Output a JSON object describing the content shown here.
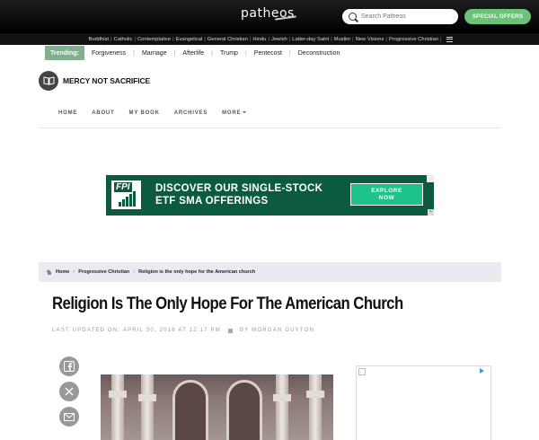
{
  "header": {
    "logo_text": "patheos",
    "search_placeholder": "Search Patheos",
    "special_offers_label": "SPECIAL OFFERS"
  },
  "categories": [
    "Buddhist",
    "Catholic",
    "Contemplative",
    "Evangelical",
    "General Christian",
    "Hindu",
    "Jewish",
    "Latter-day Saint",
    "Muslim",
    "New Visions",
    "Progressive Christian"
  ],
  "trending": {
    "label": "Trending:",
    "items": [
      "Forgiveness",
      "Marriage",
      "Afterlife",
      "Trump",
      "Pentecost",
      "Deconstruction"
    ]
  },
  "blog": {
    "title": "MERCY NOT SACRIFICE",
    "nav": [
      "HOME",
      "ABOUT",
      "MY BOOK",
      "ARCHIVES",
      "MORE"
    ]
  },
  "ad": {
    "logo": "FPI",
    "headline_line1": "DISCOVER OUR SINGLE-STOCK",
    "headline_line2": "ETF SMA OFFERINGS",
    "cta_line1": "EXPLORE",
    "cta_line2": "NOW",
    "brand_color": "#0c5b40",
    "cta_color": "#1ec28b"
  },
  "breadcrumb": [
    "Home",
    "Progressive Christian",
    "Religion is the only hope for the American church"
  ],
  "article": {
    "title": "Religion Is The Only Hope For The American Church",
    "updated": "LAST UPDATED ON: APRIL 30, 2016 AT 12:17 PM",
    "byline": "BY MORGAN GUYTON"
  },
  "share": [
    "facebook-icon",
    "x-icon",
    "mail-icon"
  ],
  "colors": {
    "topbar": "#000000",
    "accent_green": "#6cc27a",
    "trending_green": "#7fb08f",
    "breadcrumb_bg": "#eceaf1"
  }
}
